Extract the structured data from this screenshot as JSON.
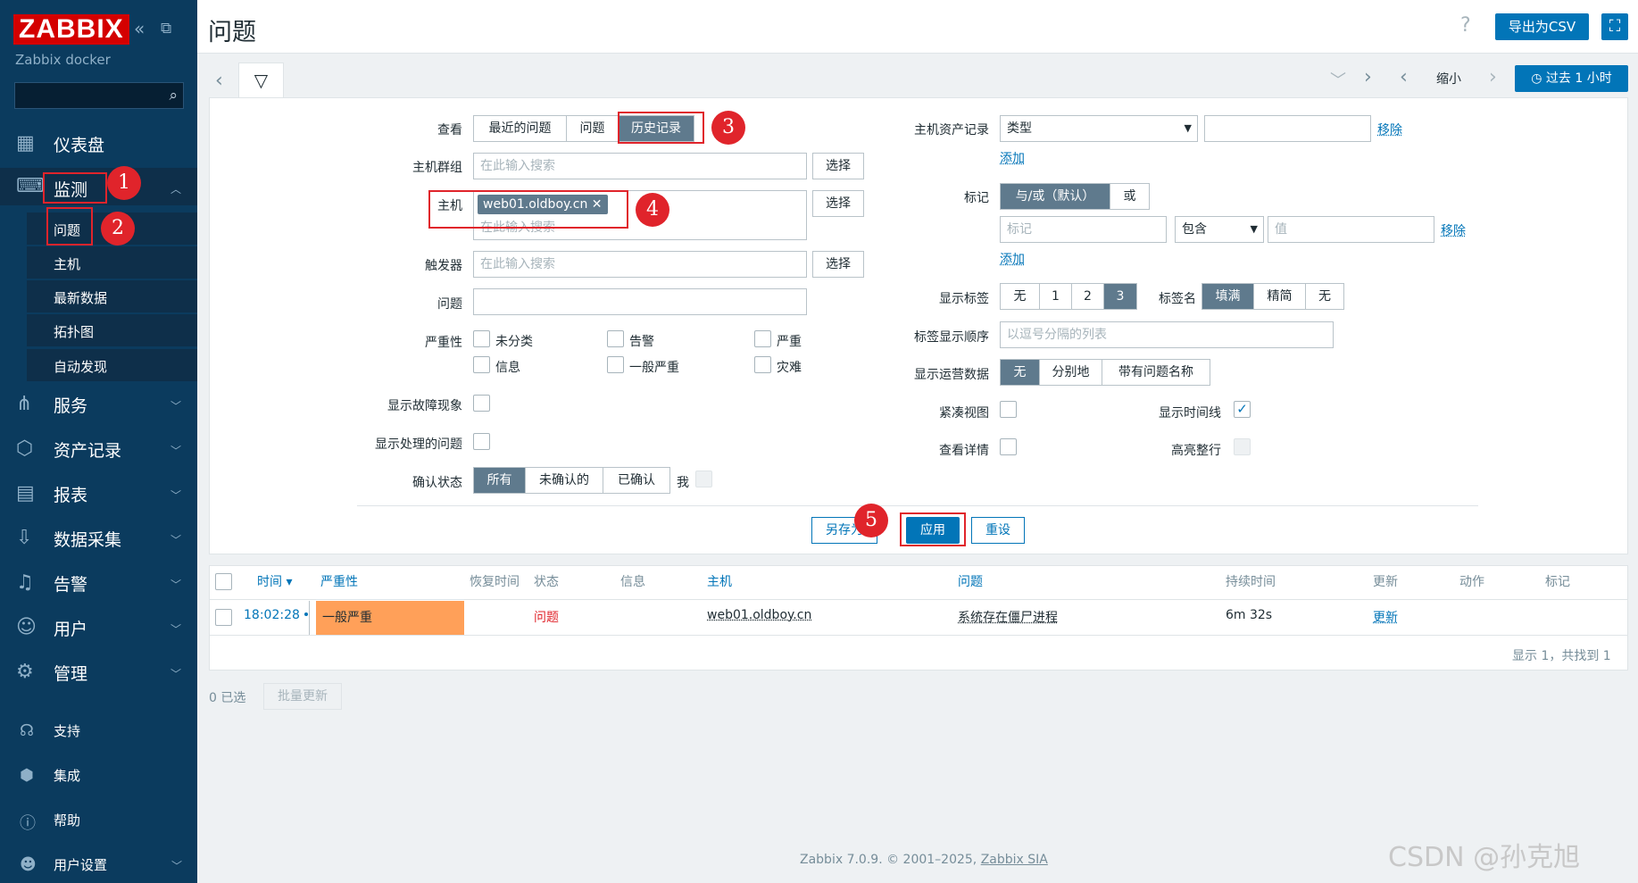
{
  "sidebar": {
    "logo": "ZABBIX",
    "subtitle": "Zabbix docker",
    "collapse_icon": "double-chevron-left-icon",
    "kiosk_icon": "kiosk-icon",
    "search_icon": "search-icon",
    "nav": [
      {
        "label": "仪表盘",
        "icon": "dashboard-icon"
      },
      {
        "label": "监测",
        "icon": "monitoring-icon"
      },
      {
        "label": "服务",
        "icon": "services-icon"
      },
      {
        "label": "资产记录",
        "icon": "inventory-icon"
      },
      {
        "label": "报表",
        "icon": "reports-icon"
      },
      {
        "label": "数据采集",
        "icon": "data-collection-icon"
      },
      {
        "label": "告警",
        "icon": "alerts-icon"
      },
      {
        "label": "用户",
        "icon": "users-icon"
      },
      {
        "label": "管理",
        "icon": "administration-icon"
      }
    ],
    "monitoring_sub": [
      "问题",
      "主机",
      "最新数据",
      "拓扑图",
      "自动发现"
    ],
    "bottom": [
      {
        "label": "支持",
        "icon": "headset-icon"
      },
      {
        "label": "集成",
        "icon": "integrations-icon"
      },
      {
        "label": "帮助",
        "icon": "help-icon"
      },
      {
        "label": "用户设置",
        "icon": "user-settings-icon"
      }
    ]
  },
  "header": {
    "title": "问题",
    "help": "?",
    "export_csv": "导出为CSV",
    "zoom_out": "缩小",
    "time_range": "过去 1 小时"
  },
  "filter": {
    "view_label": "查看",
    "view_options": [
      "最近的问题",
      "问题",
      "历史记录"
    ],
    "view_selected": 2,
    "host_group_label": "主机群组",
    "host_label": "主机",
    "host_tag": "web01.oldboy.cn",
    "trigger_label": "触发器",
    "problem_label": "问题",
    "search_placeholder": "在此输入搜索",
    "select_button": "选择",
    "severity_label": "严重性",
    "severities": [
      "未分类",
      "告警",
      "严重",
      "信息",
      "一般严重",
      "灾难"
    ],
    "show_symptoms": "显示故障现象",
    "show_suppressed": "显示处理的问题",
    "ack_status_label": "确认状态",
    "ack_options": [
      "所有",
      "未确认的",
      "已确认"
    ],
    "ack_me": "我",
    "inventory_label": "主机资产记录",
    "inventory_field": "类型",
    "remove": "移除",
    "add": "添加",
    "tags_label": "标记",
    "tags_operator": [
      "与/或（默认）",
      "或"
    ],
    "tag_placeholder": "标记",
    "tag_op_value": "包含",
    "value_placeholder": "值",
    "show_tags_label": "显示标签",
    "show_tags_options": [
      "无",
      "1",
      "2",
      "3"
    ],
    "tag_name_label": "标签名",
    "tag_name_options": [
      "填满",
      "精简",
      "无"
    ],
    "tag_order_label": "标签显示顺序",
    "tag_order_placeholder": "以逗号分隔的列表",
    "show_opdata_label": "显示运营数据",
    "opdata_options": [
      "无",
      "分别地",
      "带有问题名称"
    ],
    "compact_view": "紧凑视图",
    "show_timeline": "显示时间线",
    "show_details": "查看详情",
    "highlight_row": "高亮整行",
    "save_as": "另存为",
    "apply": "应用",
    "reset": "重设"
  },
  "table": {
    "headers": [
      "时间 ▾",
      "严重性",
      "恢复时间",
      "状态",
      "信息",
      "主机",
      "问题",
      "持续时间",
      "更新",
      "动作",
      "标记"
    ],
    "row": {
      "time": "18:02:28",
      "severity": "一般严重",
      "status": "问题",
      "host": "web01.oldboy.cn",
      "problem": "系统存在僵尸进程",
      "duration": "6m 32s",
      "update": "更新"
    },
    "summary": "显示 1，共找到 1",
    "selected": "0 已选",
    "mass_update": "批量更新"
  },
  "annotations": [
    "1",
    "2",
    "3",
    "4",
    "5"
  ],
  "footer": {
    "copyright": "Zabbix 7.0.9. © 2001–2025,",
    "company": "Zabbix SIA"
  },
  "watermark": "CSDN @孙克旭",
  "colors": {
    "sidebar": "#0b3b5e",
    "accent": "#0275b8",
    "severity_average": "#ffa059",
    "annotation": "#e0242b",
    "segment_on": "#5f7a8d"
  }
}
